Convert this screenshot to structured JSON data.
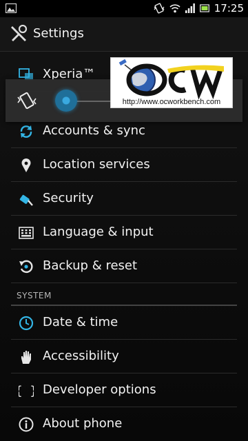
{
  "status_bar": {
    "time": "17:25",
    "icons": [
      "gallery-icon",
      "vibrate-icon",
      "wifi-icon",
      "signal-icon",
      "battery-icon"
    ]
  },
  "action_bar": {
    "title": "Settings",
    "icon": "wrench-screwdriver-icon"
  },
  "list": {
    "items": [
      {
        "label": "Xperia™",
        "icon": "xperia-icon"
      },
      {
        "label": "Accounts & sync",
        "icon": "sync-icon"
      },
      {
        "label": "Location services",
        "icon": "location-pin-icon"
      },
      {
        "label": "Security",
        "icon": "lock-icon"
      },
      {
        "label": "Language & input",
        "icon": "keyboard-icon"
      },
      {
        "label": "Backup & reset",
        "icon": "backup-icon"
      }
    ],
    "section": {
      "label": "SYSTEM"
    },
    "system_items": [
      {
        "label": "Date & time",
        "icon": "clock-icon"
      },
      {
        "label": "Accessibility",
        "icon": "hand-icon"
      },
      {
        "label": "Developer options",
        "icon": "braces-icon"
      },
      {
        "label": "About phone",
        "icon": "info-icon"
      }
    ]
  },
  "volume_overlay": {
    "icon": "vibrate-icon",
    "level": 0
  },
  "watermark": {
    "logo_text": "OCW",
    "url": "http://www.ocworkbench.com"
  },
  "colors": {
    "accent": "#33b5e5",
    "background": "#0b0b0b",
    "divider": "#2b2b2b"
  }
}
